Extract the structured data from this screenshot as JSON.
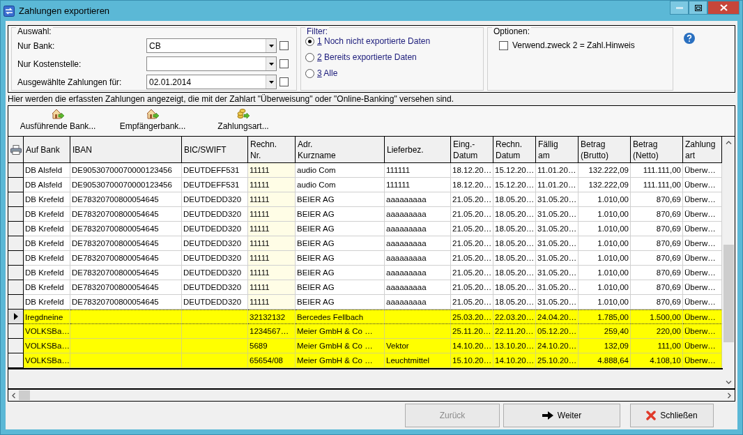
{
  "window": {
    "title": "Zahlungen exportieren"
  },
  "selection": {
    "label": "Auswahl:",
    "fields": [
      {
        "label": "Nur Bank:",
        "value": "CB",
        "checked": false
      },
      {
        "label": "Nur Kostenstelle:",
        "checked": false
      },
      {
        "label": "Ausgewählte Zahlungen für:",
        "value": "02.01.2014",
        "checked": false
      }
    ]
  },
  "filter": {
    "label": "Filter:",
    "options": [
      {
        "number": "1",
        "label": "Noch nicht exportierte Daten",
        "selected": true
      },
      {
        "number": "2",
        "label": "Bereits exportierte Daten",
        "selected": false
      },
      {
        "number": "3",
        "label": "Alle",
        "selected": false
      }
    ]
  },
  "options": {
    "label": "Optionen:",
    "items": [
      {
        "label": "Verwend.zweck 2 = Zahl.Hinweis",
        "checked": false
      }
    ]
  },
  "info_text": "Hier werden die erfassten Zahlungen angezeigt, die mit der Zahlart \"Überweisung\" oder \"Online-Banking\" versehen sind.",
  "toolbar": [
    {
      "label": "Ausführende Bank...",
      "kind": "bank"
    },
    {
      "label": "Empfängerbank...",
      "kind": "bank"
    },
    {
      "label": "Zahlungsart...",
      "kind": "coins"
    }
  ],
  "table": {
    "columns": [
      {
        "label": "Auf Bank",
        "kind": "text"
      },
      {
        "label": "IBAN",
        "kind": "text"
      },
      {
        "label": "BIC/SWIFT",
        "kind": "text"
      },
      {
        "label": "Rechn.\nNr.",
        "kind": "key"
      },
      {
        "label": "Adr.\nKurzname",
        "kind": "text"
      },
      {
        "label": "Lieferbez.",
        "kind": "text"
      },
      {
        "label": "Eing.-\nDatum",
        "kind": "text"
      },
      {
        "label": "Rechn.\nDatum",
        "kind": "text"
      },
      {
        "label": "Fällig\nam",
        "kind": "text"
      },
      {
        "label": "Betrag\n(Brutto)",
        "kind": "amount"
      },
      {
        "label": "Betrag\n(Netto)",
        "kind": "amount"
      },
      {
        "label": "Zahlung\nart",
        "kind": "text"
      }
    ],
    "rows": [
      {
        "selected": false,
        "highlighted": false,
        "cells": [
          "DB Alsfeld",
          "DE90530700070000123456",
          "DEUTDEFF531",
          "11111",
          "audio Com",
          "111111",
          "18.12.20…",
          "15.12.20…",
          "11.01.20…",
          "132.222,09",
          "111.111,00",
          "Überw…"
        ]
      },
      {
        "selected": false,
        "highlighted": false,
        "cells": [
          "DB Alsfeld",
          "DE90530700070000123456",
          "DEUTDEFF531",
          "11111",
          "audio Com",
          "111111",
          "18.12.20…",
          "15.12.20…",
          "11.01.20…",
          "132.222,09",
          "111.111,00",
          "Überw…"
        ]
      },
      {
        "selected": false,
        "highlighted": false,
        "cells": [
          "DB Krefeld",
          "DE78320700800054645",
          "DEUTDEDD320",
          "11111",
          "BEIER AG",
          "aaaaaaaaa",
          "21.05.20…",
          "18.05.20…",
          "31.05.20…",
          "1.010,00",
          "870,69",
          "Überw…"
        ]
      },
      {
        "selected": false,
        "highlighted": false,
        "cells": [
          "DB Krefeld",
          "DE78320700800054645",
          "DEUTDEDD320",
          "11111",
          "BEIER AG",
          "aaaaaaaaa",
          "21.05.20…",
          "18.05.20…",
          "31.05.20…",
          "1.010,00",
          "870,69",
          "Überw…"
        ]
      },
      {
        "selected": false,
        "highlighted": false,
        "cells": [
          "DB Krefeld",
          "DE78320700800054645",
          "DEUTDEDD320",
          "11111",
          "BEIER AG",
          "aaaaaaaaa",
          "21.05.20…",
          "18.05.20…",
          "31.05.20…",
          "1.010,00",
          "870,69",
          "Überw…"
        ]
      },
      {
        "selected": false,
        "highlighted": false,
        "cells": [
          "DB Krefeld",
          "DE78320700800054645",
          "DEUTDEDD320",
          "11111",
          "BEIER AG",
          "aaaaaaaaa",
          "21.05.20…",
          "18.05.20…",
          "31.05.20…",
          "1.010,00",
          "870,69",
          "Überw…"
        ]
      },
      {
        "selected": false,
        "highlighted": false,
        "cells": [
          "DB Krefeld",
          "DE78320700800054645",
          "DEUTDEDD320",
          "11111",
          "BEIER AG",
          "aaaaaaaaa",
          "21.05.20…",
          "18.05.20…",
          "31.05.20…",
          "1.010,00",
          "870,69",
          "Überw…"
        ]
      },
      {
        "selected": false,
        "highlighted": false,
        "cells": [
          "DB Krefeld",
          "DE78320700800054645",
          "DEUTDEDD320",
          "11111",
          "BEIER AG",
          "aaaaaaaaa",
          "21.05.20…",
          "18.05.20…",
          "31.05.20…",
          "1.010,00",
          "870,69",
          "Überw…"
        ]
      },
      {
        "selected": false,
        "highlighted": false,
        "cells": [
          "DB Krefeld",
          "DE78320700800054645",
          "DEUTDEDD320",
          "11111",
          "BEIER AG",
          "aaaaaaaaa",
          "21.05.20…",
          "18.05.20…",
          "31.05.20…",
          "1.010,00",
          "870,69",
          "Überw…"
        ]
      },
      {
        "selected": false,
        "highlighted": false,
        "cells": [
          "DB Krefeld",
          "DE78320700800054645",
          "DEUTDEDD320",
          "11111",
          "BEIER AG",
          "aaaaaaaaa",
          "21.05.20…",
          "18.05.20…",
          "31.05.20…",
          "1.010,00",
          "870,69",
          "Überw…"
        ]
      },
      {
        "selected": true,
        "highlighted": true,
        "cells": [
          "Iregdneine",
          "",
          "",
          "32132132",
          "Bercedes Fellbach",
          "",
          "25.03.20…",
          "22.03.20…",
          "24.04.20…",
          "1.785,00",
          "1.500,00",
          "Überw…"
        ]
      },
      {
        "selected": false,
        "highlighted": true,
        "cells": [
          "VOLKSBa…",
          "",
          "",
          "1234567…",
          "Meier GmbH & Co …",
          "",
          "25.11.20…",
          "22.11.20…",
          "05.12.20…",
          "259,40",
          "220,00",
          "Überw…"
        ]
      },
      {
        "selected": false,
        "highlighted": true,
        "cells": [
          "VOLKSBa…",
          "",
          "",
          "5689",
          "Meier GmbH & Co …",
          "Vektor",
          "14.10.20…",
          "13.10.20…",
          "24.10.20…",
          "132,09",
          "111,00",
          "Überw…"
        ]
      },
      {
        "selected": false,
        "highlighted": true,
        "cells": [
          "VOLKSBa…",
          "",
          "",
          "65654/08",
          "Meier GmbH & Co …",
          "Leuchtmittel",
          "15.10.20…",
          "14.10.20…",
          "25.10.20…",
          "4.888,64",
          "4.108,10",
          "Überw…"
        ]
      }
    ]
  },
  "buttons": [
    {
      "label": "Zurück",
      "disabled": true,
      "kind": "plain"
    },
    {
      "label": "Weiter",
      "disabled": false,
      "kind": "next"
    },
    {
      "label": "Schließen",
      "disabled": false,
      "kind": "close"
    }
  ]
}
